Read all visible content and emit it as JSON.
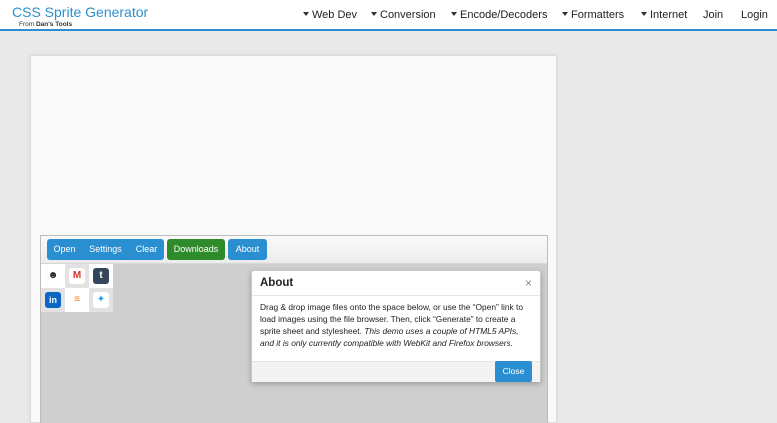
{
  "brand": {
    "title": "CSS Sprite Generator",
    "from_prefix": "From",
    "from_name": "Dan's Tools"
  },
  "nav": [
    {
      "label": "Web Dev",
      "dropdown": true
    },
    {
      "label": "Conversion",
      "dropdown": true
    },
    {
      "label": "Encode/Decoders",
      "dropdown": true
    },
    {
      "label": "Formatters",
      "dropdown": true
    },
    {
      "label": "Internet",
      "dropdown": true
    },
    {
      "label": "Join",
      "dropdown": false
    },
    {
      "label": "Login",
      "dropdown": false
    }
  ],
  "toolbar": {
    "open": "Open",
    "settings": "Settings",
    "clear": "Clear",
    "downloads": "Downloads",
    "about": "About"
  },
  "sprites": [
    {
      "icon": "github-icon",
      "glyph": "☻",
      "color": "#222222"
    },
    {
      "icon": "gmail-icon",
      "glyph": "M",
      "color": "#d93025"
    },
    {
      "icon": "tumblr-icon",
      "glyph": "t",
      "color": "#35465c"
    },
    {
      "icon": "linkedin-icon",
      "glyph": "in",
      "color": "#0a66c2"
    },
    {
      "icon": "stackoverflow-icon",
      "glyph": "≡",
      "color": "#f48024"
    },
    {
      "icon": "twitter-icon",
      "glyph": "✦",
      "color": "#1da1f2"
    }
  ],
  "modal": {
    "title": "About",
    "close_glyph": "×",
    "body_plain": "Drag & drop image files onto the space below, or use the “Open” link to load images using the file browser. Then, click “Generate” to create a sprite sheet and stylesheet. ",
    "body_italic": "This demo uses a couple of HTML5 APIs, and it is only currently compatible with WebKit and Firefox browsers.",
    "close_button": "Close"
  },
  "colors": {
    "accent": "#2a8fd0",
    "downloads": "#2e8b2a"
  }
}
